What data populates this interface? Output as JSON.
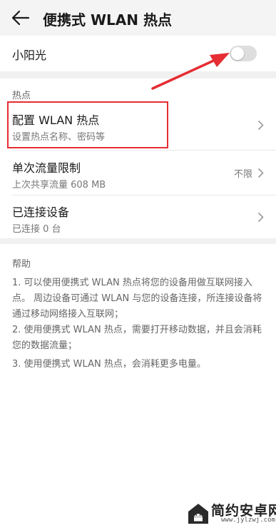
{
  "header": {
    "title": "便携式 WLAN 热点",
    "back_icon": "arrow-left-icon"
  },
  "hotspot": {
    "name": "小阳光",
    "toggle_on": false
  },
  "section": {
    "label": "热点"
  },
  "rows": [
    {
      "title": "配置 WLAN 热点",
      "subtitle": "设置热点名称、密码等",
      "value": ""
    },
    {
      "title": "单次流量限制",
      "subtitle": "上次共享流量 608 MB",
      "value": "不限"
    },
    {
      "title": "已连接设备",
      "subtitle": "已连接 0 台",
      "value": ""
    }
  ],
  "help": {
    "title": "帮助",
    "items": [
      "1. 可以使用便携式 WLAN 热点将您的设备用做互联网接入点。 周边设备可通过 WLAN 与您的设备连接，所连接设备将通过移动网络接入互联网；",
      "2. 使用便携式 WLAN 热点，需要打开移动数据，并且会消耗您的数据流量；",
      "3. 使用便携式 WLAN 热点，会消耗更多电量。"
    ]
  },
  "annotations": {
    "arrow_color": "#e52d33",
    "highlight_color": "#e52d33"
  },
  "watermark": {
    "title": "简约安卓网",
    "url": "www.jylzwj.com"
  }
}
